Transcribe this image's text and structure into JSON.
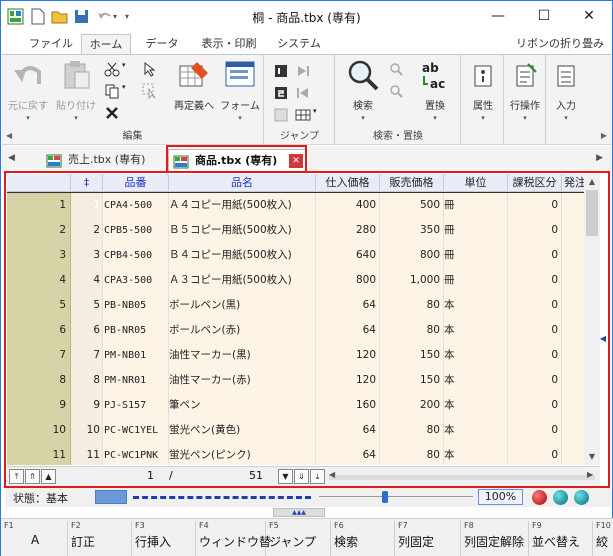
{
  "window": {
    "title": "桐 - 商品.tbx (専有)",
    "controls": {
      "minimize": "—",
      "maximize": "☐",
      "close": "✕"
    }
  },
  "ribbon_tabs": [
    "ファイル",
    "ホーム",
    "データ",
    "表示・印刷",
    "システム"
  ],
  "ribbon_active_tab": "ホーム",
  "ribbon_collapse": "リボンの折り畳み",
  "ribbon": {
    "undo": "元に戻す",
    "paste": "貼り付け",
    "redefine": "再定義へ",
    "form": "フォーム",
    "search": "検索",
    "replace": "置換",
    "attribute": "属性",
    "row_ops": "行操作",
    "input": "入力",
    "group_edit": "編集",
    "group_jump": "ジャンプ",
    "group_search": "検索・置換"
  },
  "doc_tabs": [
    {
      "label": "売上.tbx (専有)",
      "active": false
    },
    {
      "label": "商品.tbx (専有)",
      "active": true
    }
  ],
  "grid": {
    "columns": [
      {
        "label": "‡",
        "blue": true
      },
      {
        "label": "品番",
        "blue": true
      },
      {
        "label": "品名",
        "blue": true
      },
      {
        "label": "仕入価格",
        "blue": false
      },
      {
        "label": "販売価格",
        "blue": false
      },
      {
        "label": "単位",
        "blue": false
      },
      {
        "label": "課税区分",
        "blue": false
      },
      {
        "label": "発注",
        "blue": false
      }
    ],
    "rows": [
      {
        "n": "1",
        "id": "1",
        "code": "CPA4-500",
        "name": "Ａ４コピー用紙(500枚入)",
        "cost": "400",
        "price": "500",
        "unit": "冊",
        "tax": "0"
      },
      {
        "n": "2",
        "id": "2",
        "code": "CPB5-500",
        "name": "Ｂ５コピー用紙(500枚入)",
        "cost": "280",
        "price": "350",
        "unit": "冊",
        "tax": "0"
      },
      {
        "n": "3",
        "id": "3",
        "code": "CPB4-500",
        "name": "Ｂ４コピー用紙(500枚入)",
        "cost": "640",
        "price": "800",
        "unit": "冊",
        "tax": "0"
      },
      {
        "n": "4",
        "id": "4",
        "code": "CPA3-500",
        "name": "Ａ３コピー用紙(500枚入)",
        "cost": "800",
        "price": "1,000",
        "unit": "冊",
        "tax": "0"
      },
      {
        "n": "5",
        "id": "5",
        "code": "PB-NB05",
        "name": "ボールペン(黒)",
        "cost": "64",
        "price": "80",
        "unit": "本",
        "tax": "0"
      },
      {
        "n": "6",
        "id": "6",
        "code": "PB-NR05",
        "name": "ボールペン(赤)",
        "cost": "64",
        "price": "80",
        "unit": "本",
        "tax": "0"
      },
      {
        "n": "7",
        "id": "7",
        "code": "PM-NB01",
        "name": "油性マーカー(黒)",
        "cost": "120",
        "price": "150",
        "unit": "本",
        "tax": "0"
      },
      {
        "n": "8",
        "id": "8",
        "code": "PM-NR01",
        "name": "油性マーカー(赤)",
        "cost": "120",
        "price": "150",
        "unit": "本",
        "tax": "0"
      },
      {
        "n": "9",
        "id": "9",
        "code": "PJ-S157",
        "name": "筆ペン",
        "cost": "160",
        "price": "200",
        "unit": "本",
        "tax": "0"
      },
      {
        "n": "10",
        "id": "10",
        "code": "PC-WC1YEL",
        "name": "蛍光ペン(黄色)",
        "cost": "64",
        "price": "80",
        "unit": "本",
        "tax": "0"
      },
      {
        "n": "11",
        "id": "11",
        "code": "PC-WC1PNK",
        "name": "蛍光ペン(ピンク)",
        "cost": "64",
        "price": "80",
        "unit": "本",
        "tax": "0"
      }
    ]
  },
  "nav": {
    "current": "1",
    "separator": "/",
    "total": "51"
  },
  "status": {
    "label": "状態：基本",
    "zoom": "100%"
  },
  "colors": {
    "accent": "#2b79d7",
    "highlight": "#e01b1b",
    "rownum": "#d6d3a6",
    "cream": "#fdf4e6"
  },
  "function_keys": [
    {
      "no": "F1",
      "name": "A"
    },
    {
      "no": "F2",
      "name": "訂正"
    },
    {
      "no": "F3",
      "name": "行挿入"
    },
    {
      "no": "F4",
      "name": "ウィンドウ替"
    },
    {
      "no": "F5",
      "name": "ジャンプ"
    },
    {
      "no": "F6",
      "name": "検索"
    },
    {
      "no": "F7",
      "name": "列固定"
    },
    {
      "no": "F8",
      "name": "列固定解除"
    },
    {
      "no": "F9",
      "name": "並べ替え"
    },
    {
      "no": "F10",
      "name": "絞"
    }
  ]
}
